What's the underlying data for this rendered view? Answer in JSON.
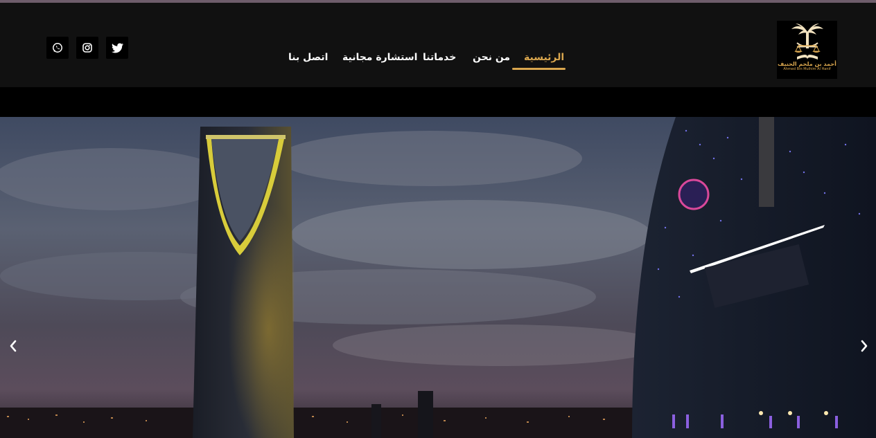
{
  "header": {
    "logo": {
      "arabic_name": "أحمد بن ملحم الحنيف",
      "english_name": "Ahmed Bin Mulhim Al Hanif"
    },
    "nav": [
      {
        "label": "الرئيسية",
        "active": true
      },
      {
        "label": "من نحن",
        "active": false
      },
      {
        "label": "خدماتنا",
        "active": false
      },
      {
        "label": "استشارة مجانية",
        "active": false
      },
      {
        "label": "اتصل بنا",
        "active": false
      }
    ],
    "social": [
      {
        "icon": "whatsapp-icon"
      },
      {
        "icon": "instagram-icon"
      },
      {
        "icon": "twitter-icon"
      }
    ]
  },
  "colors": {
    "accent": "#d9a64e",
    "header_bg": "#111111",
    "top_line": "#6e5d6b"
  },
  "hero": {
    "controls": [
      "chevron-left-icon",
      "chevron-right-icon"
    ]
  }
}
